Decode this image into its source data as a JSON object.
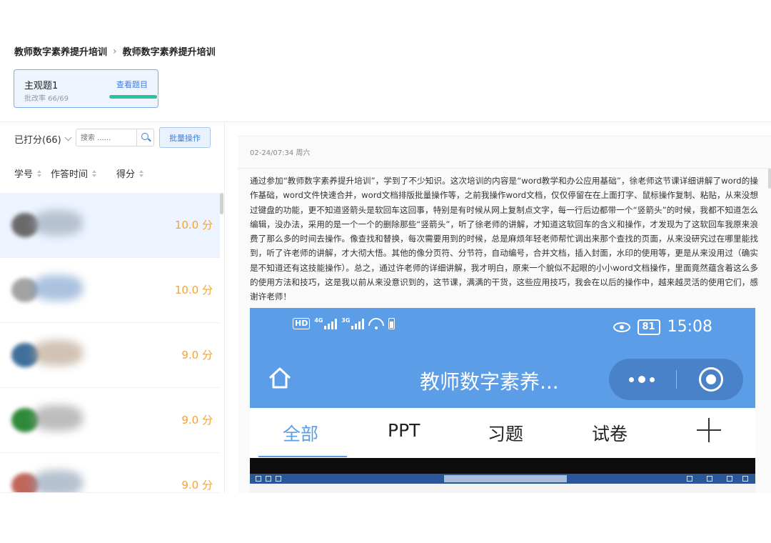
{
  "breadcrumb": [
    "教师数字素养提升培训",
    "教师数字素养提升培训"
  ],
  "topic_card": {
    "title": "主观题1",
    "view_link": "查看题目",
    "rate_label": "批改率 66/69",
    "progress_fraction": 0.957,
    "accent_color": "#2bc2a0"
  },
  "filter": {
    "label": "已打分(66)",
    "search_placeholder": "搜索 ......",
    "batch_button": "批量操作"
  },
  "columns": [
    "学号",
    "作答时间",
    "得分"
  ],
  "rows": [
    {
      "score": "10.0 分",
      "selected": true
    },
    {
      "score": "10.0 分",
      "selected": false
    },
    {
      "score": "9.0 分",
      "selected": false
    },
    {
      "score": "9.0 分",
      "selected": false
    },
    {
      "score": "9.0 分",
      "selected": false
    }
  ],
  "score_color": "#f3a23a",
  "detail": {
    "timestamp": "02-24/07:34 周六",
    "essay": "通过参加“教师数字素养提升培训”，学到了不少知识。这次培训的内容是“word教学和办公应用基础”，徐老师这节课详细讲解了word的操作基础，word文件快速合并，word文档排版批量操作等，之前我操作word文档，仅仅停留在在上面打字、鼠标操作复制、粘贴，从来没想过键盘的功能，更不知道竖箭头是软回车这回事，特别是有时候从网上复制点文字，每一行后边都带一个“竖箭头”的时候，我都不知道怎么编辑，没办法，采用的是一个一个的删除那些“竖箭头”，听了徐老师的讲解，才知道这软回车的含义和操作，才发现为了这软回车我原来浪费了那么多的时间去操作。像查找和替换，每次需要用到的时候，总是麻烦年轻老师帮忙调出来那个查找的页面，从来没研究过在哪里能找到，听了许老师的讲解，才大彻大悟。其他的像分页符、分节符，自动编号，合并文档，插入封面，水印的使用等，更是从来没用过（确实是不知道还有这技能操作）。总之，通过许老师的详细讲解，我才明白，原来一个貌似不起眼的小小word文档操作，里面竟然蕴含着这么多的使用方法和技巧，这是我以前从来没意识到的，这节课，满满的干货，这些应用技巧，我会在以后的操作中，越来越灵活的使用它们，感谢许老师！"
  },
  "phone": {
    "status": {
      "hd_label": "HD",
      "sim1_label": "4G",
      "sim2_label": "3G",
      "battery": "81",
      "time": "15:08"
    },
    "app_title": "教师数字素养...",
    "tabs": [
      "全部",
      "PPT",
      "习题",
      "试卷"
    ],
    "active_tab_index": 0,
    "accent_color": "#5b9de6",
    "icons": [
      "home-icon",
      "more-dots-icon",
      "close-target-icon",
      "plus-icon",
      "eye-icon",
      "wifi-icon"
    ]
  }
}
